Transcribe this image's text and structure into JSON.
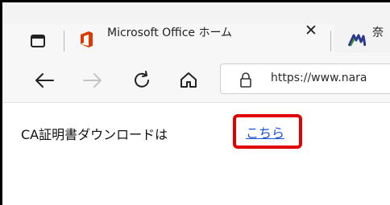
{
  "browser": {
    "tabs": [
      {
        "title": "Microsoft Office ホーム",
        "icon": "office-logo-icon",
        "active": true,
        "close_label": "✕"
      },
      {
        "title": "奈",
        "icon": "nara-logo-icon",
        "active": false
      }
    ],
    "toolbar": {
      "back_icon": "arrow-left-icon",
      "forward_icon": "arrow-right-icon",
      "refresh_icon": "refresh-icon",
      "home_icon": "home-icon",
      "url": "https://www.nara"
    }
  },
  "page": {
    "ca_text": "CA証明書ダウンロードは",
    "link_label": "こちら"
  },
  "colors": {
    "highlight_border": "#e00000",
    "link": "#1a55d6",
    "office_icon": "#d83b01",
    "nara_icon": "#2a3a8a"
  }
}
